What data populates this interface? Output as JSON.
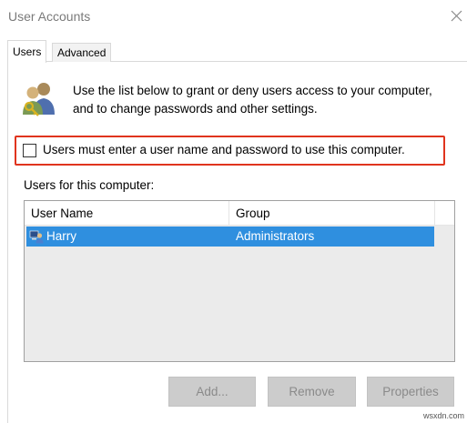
{
  "window": {
    "title": "User Accounts"
  },
  "tabs": [
    {
      "label": "Users",
      "active": true
    },
    {
      "label": "Advanced",
      "active": false
    }
  ],
  "intro_text": "Use the list below to grant or deny users access to your computer, and to change passwords and other settings.",
  "login_checkbox": {
    "label": "Users must enter a user name and password to use this computer.",
    "checked": false
  },
  "users_list": {
    "caption": "Users for this computer:",
    "columns": [
      "User Name",
      "Group"
    ],
    "rows": [
      {
        "name": "Harry",
        "group": "Administrators",
        "selected": true
      }
    ]
  },
  "buttons": {
    "add": "Add...",
    "remove": "Remove",
    "properties": "Properties"
  },
  "watermark": "wsxdn.com",
  "colors": {
    "selection": "#2f8fdf",
    "highlight_border": "#e0341e",
    "disabled_button": "#cccccc"
  }
}
